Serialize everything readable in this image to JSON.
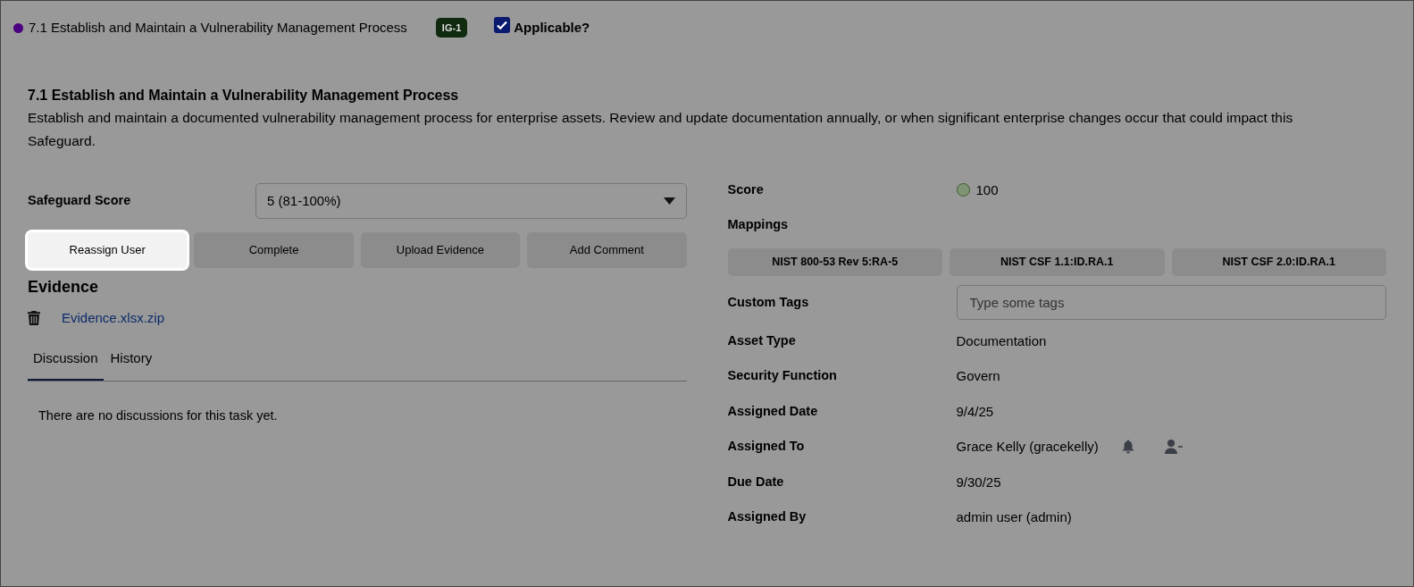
{
  "header": {
    "color": "#4b0082",
    "title": "7.1 Establish and Maintain a Vulnerability Management Process",
    "badge": "IG-1",
    "applicable": {
      "label": "Applicable?",
      "checked": true
    }
  },
  "safeguard": {
    "title": "7.1 Establish and Maintain a Vulnerability Management Process",
    "description": "Establish and maintain a documented vulnerability management process for enterprise assets. Review and update documentation annually, or when significant enterprise changes occur that could impact this Safeguard."
  },
  "safeguard_score": {
    "label": "Safeguard Score",
    "value": "5 (81-100%)"
  },
  "actions": [
    {
      "label": "Reassign User",
      "highlighted": true
    },
    {
      "label": "Complete",
      "highlighted": false
    },
    {
      "label": "Upload Evidence",
      "highlighted": false
    },
    {
      "label": "Add Comment",
      "highlighted": false
    }
  ],
  "evidence": {
    "title": "Evidence",
    "files": [
      {
        "name": "Evidence.xlsx.zip"
      }
    ]
  },
  "tabs": [
    {
      "label": "Discussion",
      "selected": true
    },
    {
      "label": "History",
      "selected": false
    }
  ],
  "empty_message": "There are no discussions for this task yet.",
  "score": {
    "label": "Score",
    "value": "100",
    "color": "#7f9475"
  },
  "mappings": {
    "label": "Mappings",
    "items": [
      "NIST 800-53 Rev 5:RA-5",
      "NIST CSF 1.1:ID.RA.1",
      "NIST CSF 2.0:ID.RA.1"
    ]
  },
  "custom_tags": {
    "label": "Custom Tags",
    "placeholder": "Type some tags"
  },
  "fields": [
    {
      "label": "Asset Type",
      "value": "Documentation",
      "kind": "text"
    },
    {
      "label": "Security Function",
      "value": "Govern",
      "kind": "text"
    },
    {
      "label": "Assigned Date",
      "value": "9/4/25",
      "kind": "text"
    },
    {
      "label": "Assigned To",
      "value": "Grace Kelly (gracekelly)",
      "kind": "user"
    },
    {
      "label": "Due Date",
      "value": "9/30/25",
      "kind": "text"
    },
    {
      "label": "Assigned By",
      "value": "admin user (admin)",
      "kind": "text"
    }
  ]
}
